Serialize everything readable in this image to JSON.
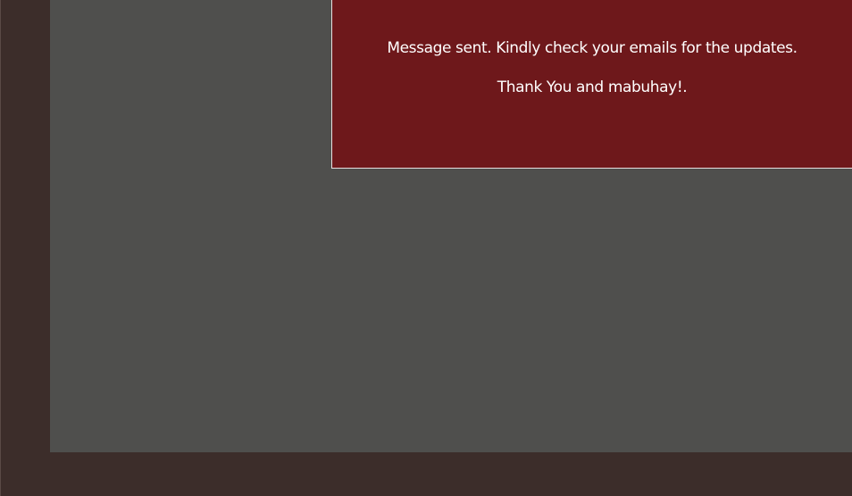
{
  "notification": {
    "message": "Message sent. Kindly check your emails for the updates.",
    "thanks": "Thank You and mabuhay!."
  },
  "colors": {
    "frame_background": "#3c2d2a",
    "content_background": "#4f4f4d",
    "message_background": "#6e181b",
    "message_text": "#ffffff",
    "message_border": "#e8e0e0"
  }
}
